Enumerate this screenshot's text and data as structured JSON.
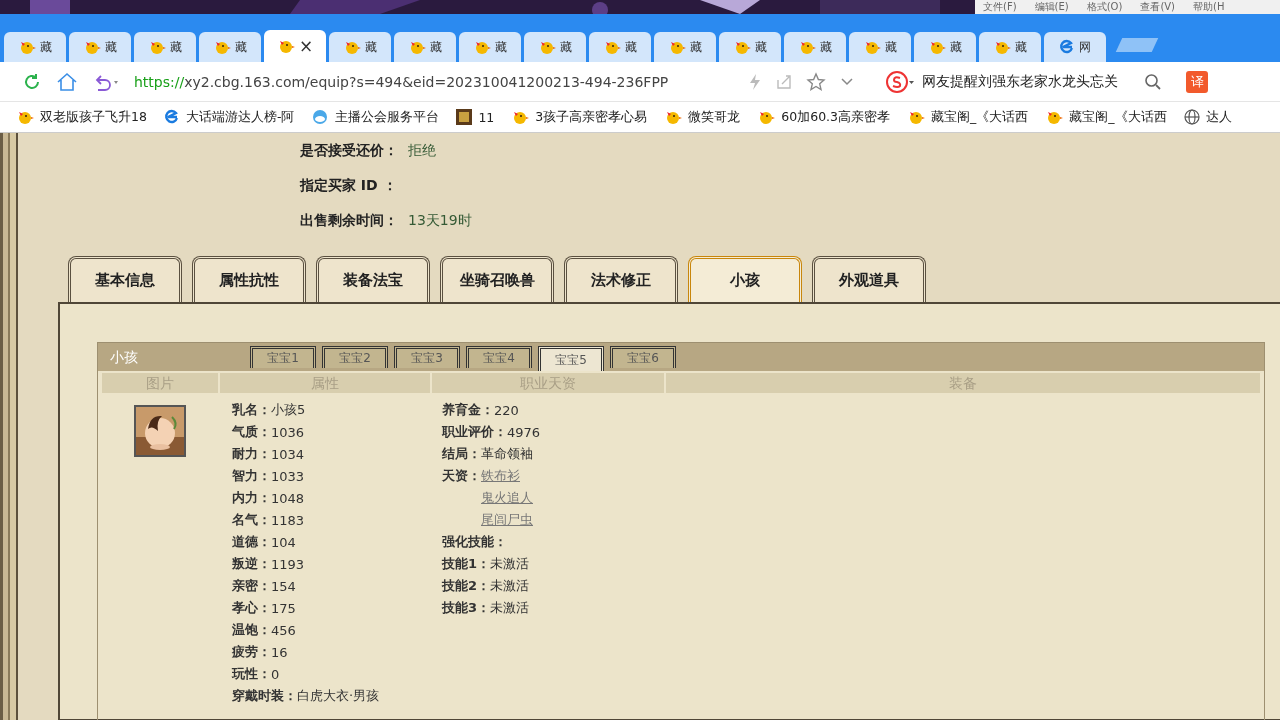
{
  "notepad_menu": [
    "文件(F)",
    "编辑(E)",
    "格式(O)",
    "查看(V)",
    "帮助(H"
  ],
  "browser_tabs": [
    {
      "label": "藏",
      "kind": "site",
      "selected": false
    },
    {
      "label": "藏",
      "kind": "site",
      "selected": false
    },
    {
      "label": "藏",
      "kind": "site",
      "selected": false
    },
    {
      "label": "藏",
      "kind": "site",
      "selected": false
    },
    {
      "label": "×",
      "kind": "site",
      "selected": true
    },
    {
      "label": "藏",
      "kind": "site",
      "selected": false
    },
    {
      "label": "藏",
      "kind": "site",
      "selected": false
    },
    {
      "label": "藏",
      "kind": "site",
      "selected": false
    },
    {
      "label": "藏",
      "kind": "site",
      "selected": false
    },
    {
      "label": "藏",
      "kind": "site",
      "selected": false
    },
    {
      "label": "藏",
      "kind": "site",
      "selected": false
    },
    {
      "label": "藏",
      "kind": "site",
      "selected": false
    },
    {
      "label": "藏",
      "kind": "site",
      "selected": false
    },
    {
      "label": "藏",
      "kind": "site",
      "selected": false
    },
    {
      "label": "藏",
      "kind": "site",
      "selected": false
    },
    {
      "label": "藏",
      "kind": "site",
      "selected": false
    },
    {
      "label": "网",
      "kind": "web",
      "selected": false
    }
  ],
  "address_bar": {
    "url_scheme": "https://",
    "url_rest": "xy2.cbg.163.com/equip?s=494&eid=202310041200213-494-236FPP",
    "search_text": "网友提醒刘强东老家水龙头忘关",
    "translate": "译"
  },
  "bookmarks": [
    {
      "label": "双老版孩子飞升18",
      "kind": "chick"
    },
    {
      "label": "大话端游达人榜-阿",
      "kind": "web"
    },
    {
      "label": "主播公会服务平台",
      "kind": "cloud"
    },
    {
      "label": "11",
      "kind": "game"
    },
    {
      "label": "3孩子高亲密孝心易",
      "kind": "chick"
    },
    {
      "label": "微笑哥龙",
      "kind": "chick"
    },
    {
      "label": "60加60.3高亲密孝",
      "kind": "chick"
    },
    {
      "label": "藏宝阁_《大话西",
      "kind": "chick"
    },
    {
      "label": "藏宝阁_《大话西",
      "kind": "chick"
    },
    {
      "label": "达人",
      "kind": "globe"
    }
  ],
  "sale_info": [
    {
      "label": "是否接受还价：",
      "value": "拒绝"
    },
    {
      "label": "指定买家 ID ："
    },
    {
      "label": "出售剩余时间：",
      "value": "13天19时"
    }
  ],
  "section_tabs": [
    {
      "label": "基本信息",
      "selected": false
    },
    {
      "label": "属性抗性",
      "selected": false
    },
    {
      "label": "装备法宝",
      "selected": false
    },
    {
      "label": "坐骑召唤兽",
      "selected": false
    },
    {
      "label": "法术修正",
      "selected": false
    },
    {
      "label": "小孩",
      "selected": true
    },
    {
      "label": "外观道具",
      "selected": false
    }
  ],
  "child_panel": {
    "title": "小孩",
    "tabs": [
      {
        "label": "宝宝1",
        "selected": false
      },
      {
        "label": "宝宝2",
        "selected": false
      },
      {
        "label": "宝宝3",
        "selected": false
      },
      {
        "label": "宝宝4",
        "selected": false
      },
      {
        "label": "宝宝5",
        "selected": true
      },
      {
        "label": "宝宝6",
        "selected": false
      }
    ],
    "columns": [
      "图片",
      "属性",
      "职业天资",
      "装备"
    ],
    "portrait": {
      "kind": "picture"
    },
    "attributes": [
      {
        "label": "乳名：",
        "value": "小孩5"
      },
      {
        "label": "气质：",
        "value": "1036"
      },
      {
        "label": "耐力：",
        "value": "1034"
      },
      {
        "label": "智力：",
        "value": "1033"
      },
      {
        "label": "内力：",
        "value": "1048"
      },
      {
        "label": "名气：",
        "value": "1183"
      },
      {
        "label": "道德：",
        "value": "104"
      },
      {
        "label": "叛逆：",
        "value": "1193"
      },
      {
        "label": "亲密：",
        "value": "154"
      },
      {
        "label": "孝心：",
        "value": "175"
      },
      {
        "label": "温饱：",
        "value": "456"
      },
      {
        "label": "疲劳：",
        "value": "16"
      },
      {
        "label": "玩性：",
        "value": "0"
      },
      {
        "label": "穿戴时装：",
        "value": "白虎大衣·男孩"
      }
    ],
    "career": [
      {
        "kind": "field",
        "label": "养育金：",
        "value": "220"
      },
      {
        "kind": "field",
        "label": "职业评价：",
        "value": "4976"
      },
      {
        "kind": "field",
        "label": "结局：",
        "value": "革命领袖"
      },
      {
        "kind": "links",
        "label": "天资：",
        "links": [
          "铁布衫",
          "鬼火追人",
          "尾闾尸虫"
        ]
      },
      {
        "kind": "heading",
        "label": "强化技能："
      },
      {
        "kind": "field",
        "label": "技能1：",
        "value": "未激活"
      },
      {
        "kind": "field",
        "label": "技能2：",
        "value": "未激活"
      },
      {
        "kind": "field",
        "label": "技能3：",
        "value": "未激活"
      }
    ]
  }
}
